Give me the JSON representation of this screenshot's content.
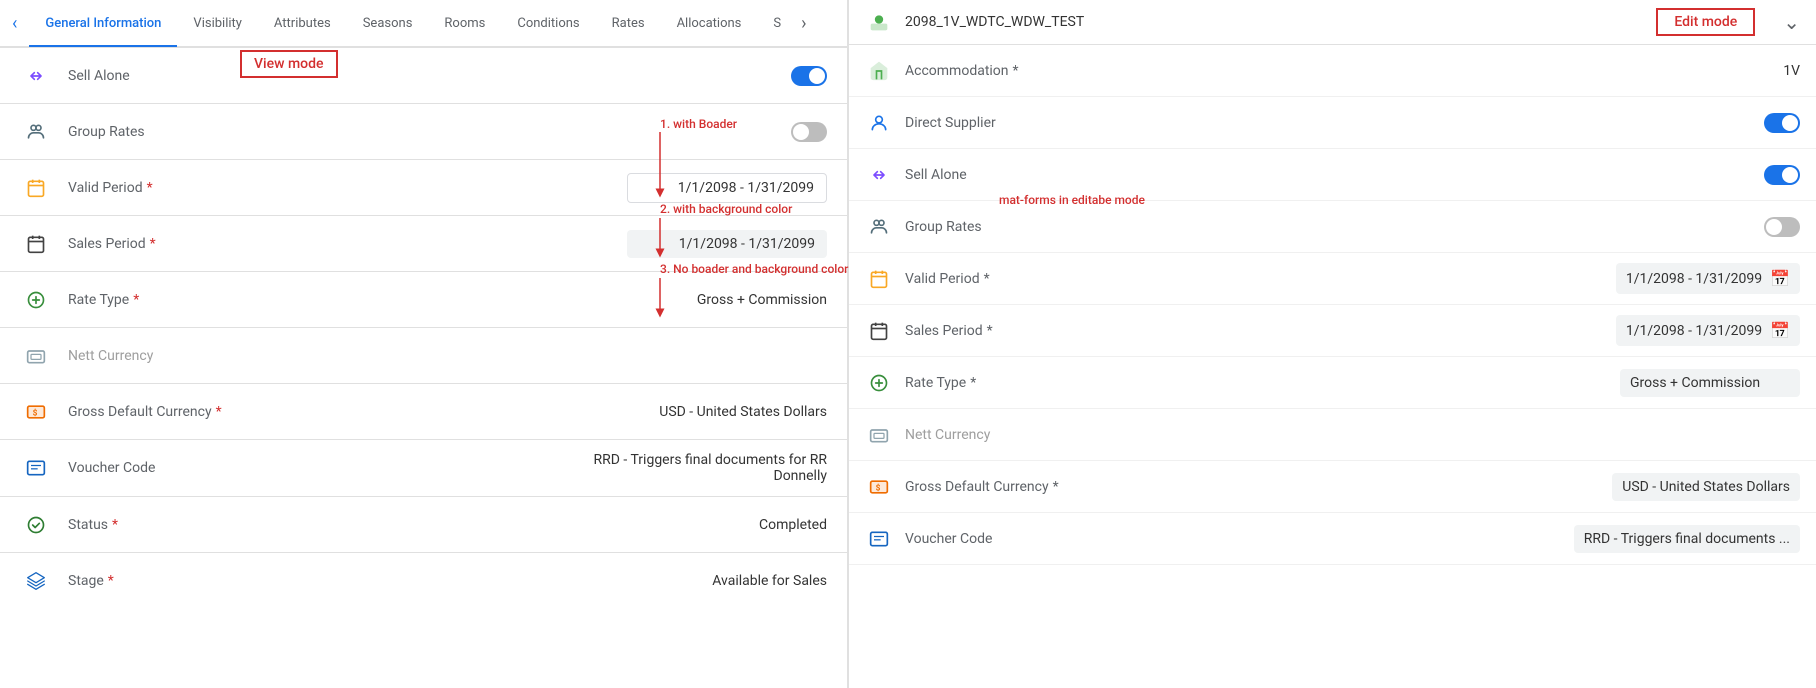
{
  "tabs": {
    "back_icon": "‹",
    "items": [
      {
        "label": "General Information",
        "active": true
      },
      {
        "label": "Visibility",
        "active": false
      },
      {
        "label": "Attributes",
        "active": false
      },
      {
        "label": "Seasons",
        "active": false
      },
      {
        "label": "Rooms",
        "active": false
      },
      {
        "label": "Conditions",
        "active": false
      },
      {
        "label": "Rates",
        "active": false
      },
      {
        "label": "Allocations",
        "active": false
      },
      {
        "label": "S",
        "active": false
      }
    ],
    "more_icon": "›"
  },
  "view_mode_label": "View mode",
  "annotation1": "1. with Boader",
  "annotation2": "2. with background color",
  "annotation3": "3. No boader and background color",
  "form_rows": [
    {
      "id": "sell-alone",
      "icon_type": "sell-alone",
      "label": "Sell Alone",
      "required": false,
      "value_type": "toggle",
      "toggle_on": true
    },
    {
      "id": "group-rates",
      "icon_type": "group",
      "label": "Group Rates",
      "required": false,
      "value_type": "toggle",
      "toggle_on": false
    },
    {
      "id": "valid-period",
      "icon_type": "calendar-yellow",
      "label": "Valid Period",
      "required": true,
      "value_type": "text-border",
      "value": "1/1/2098 - 1/31/2099"
    },
    {
      "id": "sales-period",
      "icon_type": "calendar-dark",
      "label": "Sales Period",
      "required": true,
      "value_type": "text-bg",
      "value": "1/1/2098 - 1/31/2099"
    },
    {
      "id": "rate-type",
      "icon_type": "globe",
      "label": "Rate Type",
      "required": true,
      "value_type": "text-plain",
      "value": "Gross + Commission"
    },
    {
      "id": "nett-currency",
      "icon_type": "nett",
      "label": "Nett Currency",
      "required": false,
      "value_type": "label-only",
      "value": ""
    },
    {
      "id": "gross-default-currency",
      "icon_type": "dollar",
      "label": "Gross Default Currency",
      "required": true,
      "value_type": "text-plain",
      "value": "USD - United States Dollars"
    },
    {
      "id": "voucher-code",
      "icon_type": "voucher",
      "label": "Voucher Code",
      "required": false,
      "value_type": "text-plain",
      "value": "RRD - Triggers final documents for RR Donnelly"
    },
    {
      "id": "status",
      "icon_type": "status",
      "label": "Status",
      "required": true,
      "value_type": "text-plain",
      "value": "Completed"
    },
    {
      "id": "stage",
      "icon_type": "stage",
      "label": "Stage",
      "required": true,
      "value_type": "text-plain",
      "value": "Available for Sales"
    }
  ],
  "right_panel": {
    "product_id": "2098_1V_WDTC_WDW_TEST",
    "edit_mode_label": "Edit mode",
    "accommodation_label": "Accommodation",
    "accommodation_required": true,
    "accommodation_value": "1V",
    "direct_supplier_label": "Direct Supplier",
    "sell_alone_label": "Sell Alone",
    "group_rates_label": "Group Rates",
    "valid_period_label": "Valid Period",
    "valid_period_value": "1/1/2098 - 1/31/2099",
    "sales_period_label": "Sales Period",
    "sales_period_value": "1/1/2098 - 1/31/2099",
    "rate_type_label": "Rate Type",
    "rate_type_value": "Gross + Commission",
    "nett_currency_label": "Nett Currency",
    "gross_default_currency_label": "Gross Default Currency",
    "gross_default_currency_value": "USD - United States Dollars",
    "voucher_code_label": "Voucher Code",
    "voucher_code_value": "RRD - Triggers final documents ...",
    "annotation_editmode": "mat-forms in editabe mode"
  }
}
